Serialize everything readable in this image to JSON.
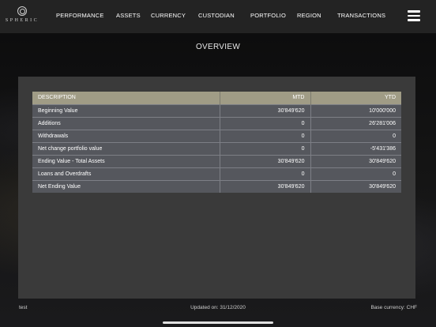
{
  "brand": {
    "logo_text": "SPHERIC"
  },
  "nav": {
    "items": [
      "PERFORMANCE",
      "ASSETS",
      "CURRENCY",
      "CUSTODIAN",
      "PORTFOLIO",
      "REGION",
      "TRANSACTIONS"
    ]
  },
  "page": {
    "title": "OVERVIEW"
  },
  "table": {
    "headers": [
      "DESCRIPTION",
      "MTD",
      "YTD"
    ],
    "rows": [
      [
        "Beginning Value",
        "30'849'620",
        "10'000'000"
      ],
      [
        "Additions",
        "0",
        "26'281'006"
      ],
      [
        "Withdrawals",
        "0",
        "0"
      ],
      [
        "Net change portfolio value",
        "0",
        "-5'431'386"
      ],
      [
        "Ending Value - Total Assets",
        "30'849'620",
        "30'849'620"
      ],
      [
        "Loans and Overdrafts",
        "0",
        "0"
      ],
      [
        "Net Ending Value",
        "30'849'620",
        "30'849'620"
      ]
    ]
  },
  "footer": {
    "user": "test",
    "updated": "Updated on: 31/12/2020",
    "currency": "Base currency: CHF"
  }
}
